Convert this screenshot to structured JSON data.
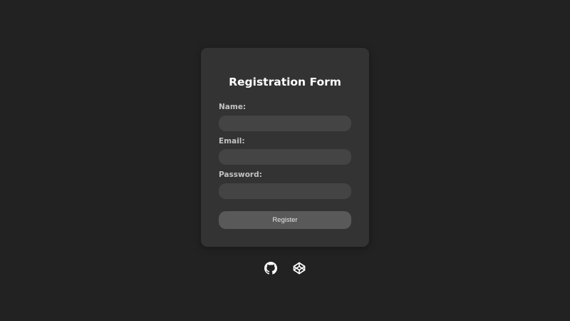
{
  "form": {
    "title": "Registration Form",
    "fields": [
      {
        "label": "Name:",
        "value": "",
        "placeholder": ""
      },
      {
        "label": "Email:",
        "value": "",
        "placeholder": ""
      },
      {
        "label": "Password:",
        "value": "",
        "placeholder": ""
      }
    ],
    "submit_label": "Register"
  },
  "footer": {
    "links": [
      {
        "icon": "github-icon"
      },
      {
        "icon": "codepen-icon"
      }
    ]
  },
  "colors": {
    "page_background": "#222222",
    "card_background": "#333333",
    "input_background": "#444444",
    "button_background": "#595959",
    "title_text": "#ffffff",
    "label_text": "#c2c2c2"
  }
}
